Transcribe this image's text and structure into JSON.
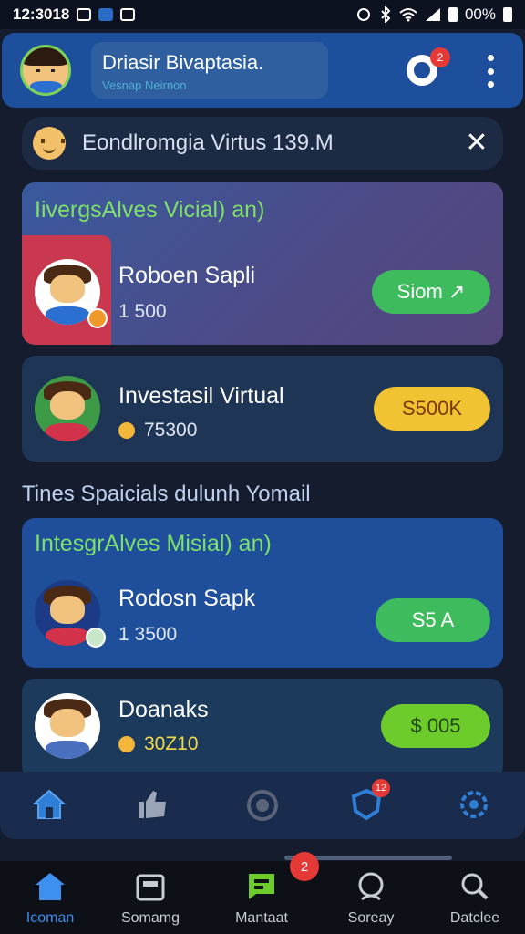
{
  "status_bar": {
    "time": "12:3018",
    "battery": "00%"
  },
  "header": {
    "title": "Driasir Bivaptasia.",
    "subtitle": "Vesnap Neirnon",
    "notification_count": "2"
  },
  "search": {
    "text": "Eondlromgia Virtus 139.M"
  },
  "card1": {
    "heading": "IivergsAlves Vicial) an)",
    "name": "Roboen Sapli",
    "amount": "1  500",
    "button": "Siom ↗"
  },
  "card2": {
    "name": "Investasil Virtual",
    "amount": "75300",
    "button": "S500K"
  },
  "section_label": "Tines Spaicials dulunh Yomail",
  "card3": {
    "heading": "IntesgrAlves Misial) an)",
    "name": "Rodosn Sapk",
    "amount": "1 3500",
    "button": "S5 A"
  },
  "card4": {
    "name": "Doanaks",
    "amount": "30Z10",
    "button": "$ 005"
  },
  "tab_strip": {
    "badge": "12"
  },
  "bottom_nav": {
    "items": [
      {
        "label": "Icoman",
        "icon": "home-icon"
      },
      {
        "label": "Somamg",
        "icon": "calendar-icon"
      },
      {
        "label": "Mantaat",
        "icon": "chat-icon"
      },
      {
        "label": "Soreay",
        "icon": "profile-icon"
      },
      {
        "label": "Datclee",
        "icon": "search-icon"
      }
    ],
    "badge": "2"
  },
  "colors": {
    "accent_blue": "#1e4f9c",
    "accent_green": "#3dbb5d",
    "accent_yellow": "#f1c232",
    "heading_green": "#7ee06a",
    "badge_red": "#e53935"
  }
}
